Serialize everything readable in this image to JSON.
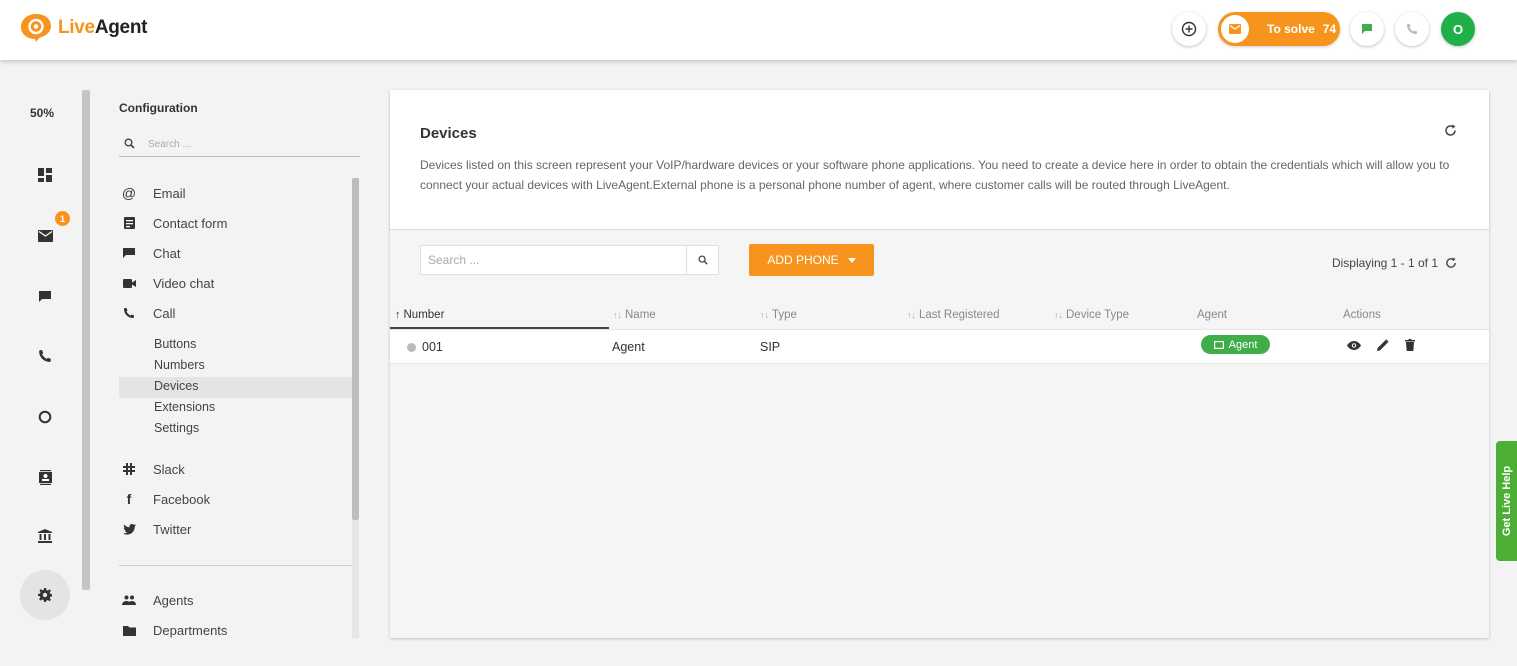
{
  "app": {
    "logo_live": "Live",
    "logo_agent": "Agent"
  },
  "topbar": {
    "to_solve_label": "To solve",
    "to_solve_count": "74",
    "avatar_initial": "O"
  },
  "leftnav": {
    "zoom": "50%",
    "mail_badge": "1"
  },
  "config": {
    "title": "Configuration",
    "search_placeholder": "Search ...",
    "items": [
      {
        "label": "Email",
        "icon": "at-icon"
      },
      {
        "label": "Contact form",
        "icon": "form-icon"
      },
      {
        "label": "Chat",
        "icon": "chat-icon"
      },
      {
        "label": "Video chat",
        "icon": "video-icon"
      },
      {
        "label": "Call",
        "icon": "phone-icon"
      }
    ],
    "call_subitems": [
      "Buttons",
      "Numbers",
      "Devices",
      "Extensions",
      "Settings"
    ],
    "integrations": [
      {
        "label": "Slack",
        "icon": "slack-icon"
      },
      {
        "label": "Facebook",
        "icon": "facebook-icon"
      },
      {
        "label": "Twitter",
        "icon": "twitter-icon"
      }
    ],
    "bottom_items": [
      {
        "label": "Agents",
        "icon": "agents-icon"
      },
      {
        "label": "Departments",
        "icon": "folder-icon"
      }
    ]
  },
  "main": {
    "title": "Devices",
    "description": "Devices listed on this screen represent your VoIP/hardware devices or your software phone applications. You need to create a device here in order to obtain the credentials which will allow you to connect your actual devices with LiveAgent.External phone is a personal phone number of agent, where customer calls will be routed through LiveAgent.",
    "search_placeholder": "Search ...",
    "add_phone_label": "ADD PHONE",
    "displaying": "Displaying 1 - 1 of 1",
    "columns": [
      "Number",
      "Name",
      "Type",
      "Last Registered",
      "Device Type",
      "Agent",
      "Actions"
    ],
    "rows": [
      {
        "number": "001",
        "name": "Agent",
        "type": "SIP",
        "last_registered": "",
        "device_type": "",
        "agent": "Agent"
      }
    ]
  },
  "live_help": "Get Live Help",
  "colors": {
    "brand": "#f7941d",
    "success": "#3fae49",
    "avatar": "#20b04a"
  }
}
